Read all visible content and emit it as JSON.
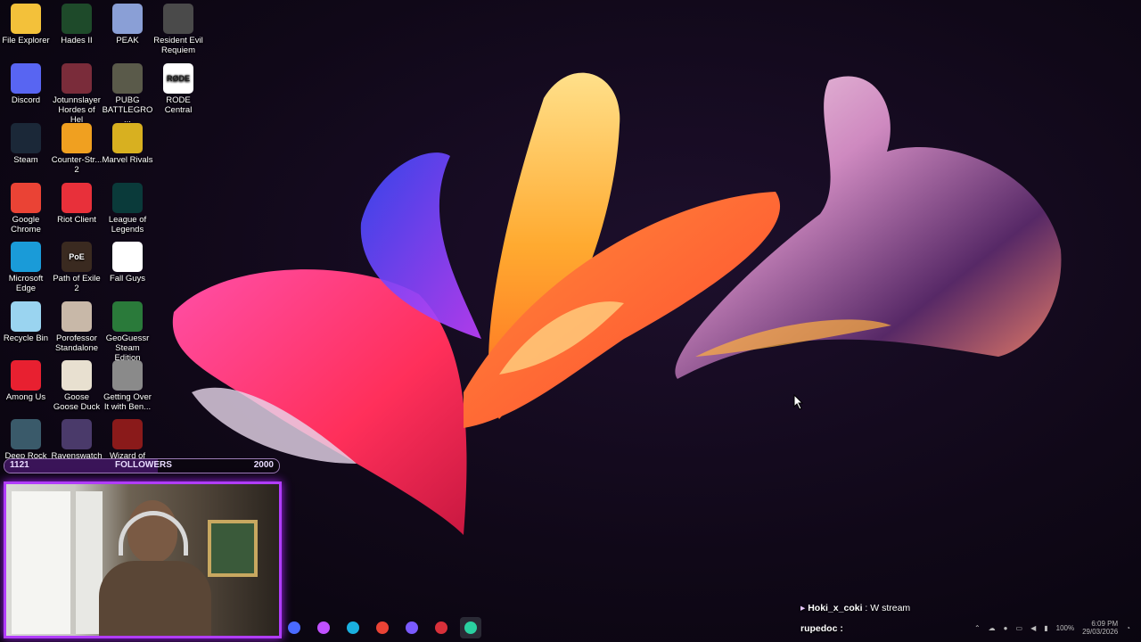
{
  "desktop": {
    "icons": [
      {
        "label": "File Explorer",
        "icon": "folder-icon",
        "color": "#f3c13a",
        "glyph": ""
      },
      {
        "label": "Hades II",
        "icon": "hades-icon",
        "color": "#1e4a2a",
        "glyph": ""
      },
      {
        "label": "PEAK",
        "icon": "peak-icon",
        "color": "#8a9fd6",
        "glyph": ""
      },
      {
        "label": "Resident Evil Requiem",
        "icon": "resident-evil-icon",
        "color": "#4a4a4a",
        "glyph": ""
      },
      {
        "label": "Discord",
        "icon": "discord-icon",
        "color": "#5865f2",
        "glyph": ""
      },
      {
        "label": "Jotunnslayer Hordes of Hel",
        "icon": "jotunnslayer-icon",
        "color": "#7a2c3a",
        "glyph": ""
      },
      {
        "label": "PUBG BATTLEGRO...",
        "icon": "pubg-icon",
        "color": "#5a5a4a",
        "glyph": ""
      },
      {
        "label": "RODE Central",
        "icon": "rode-icon",
        "color": "#ffffff",
        "glyph": "RØDE"
      },
      {
        "label": "Steam",
        "icon": "steam-icon",
        "color": "#1b2838",
        "glyph": ""
      },
      {
        "label": "Counter-Str... 2",
        "icon": "counter-strike-icon",
        "color": "#f0a020",
        "glyph": ""
      },
      {
        "label": "Marvel Rivals",
        "icon": "marvel-rivals-icon",
        "color": "#d8b020",
        "glyph": ""
      },
      {
        "label": "Google Chrome",
        "icon": "chrome-icon",
        "color": "#ea4335",
        "glyph": ""
      },
      {
        "label": "Riot Client",
        "icon": "riot-icon",
        "color": "#e8303a",
        "glyph": ""
      },
      {
        "label": "League of Legends",
        "icon": "league-icon",
        "color": "#0a3a3a",
        "glyph": ""
      },
      {
        "label": "Microsoft Edge",
        "icon": "edge-icon",
        "color": "#1a9bd8",
        "glyph": ""
      },
      {
        "label": "Path of Exile 2",
        "icon": "path-of-exile-icon",
        "color": "#3a2a20",
        "glyph": "PoE"
      },
      {
        "label": "Fall Guys",
        "icon": "file-icon",
        "color": "#ffffff",
        "glyph": ""
      },
      {
        "label": "Recycle Bin",
        "icon": "recycle-bin-icon",
        "color": "#9ad4f0",
        "glyph": ""
      },
      {
        "label": "Porofessor Standalone",
        "icon": "porofessor-icon",
        "color": "#c8b8a8",
        "glyph": ""
      },
      {
        "label": "GeoGuessr Steam Edition",
        "icon": "geoguessr-icon",
        "color": "#2a7a3a",
        "glyph": ""
      },
      {
        "label": "Among Us",
        "icon": "among-us-icon",
        "color": "#e82030",
        "glyph": ""
      },
      {
        "label": "Goose Goose Duck",
        "icon": "goose-icon",
        "color": "#e8e0d0",
        "glyph": ""
      },
      {
        "label": "Getting Over It with Ben...",
        "icon": "hammer-icon",
        "color": "#8a8a8a",
        "glyph": ""
      },
      {
        "label": "Deep Rock",
        "icon": "deep-rock-icon",
        "color": "#3a5a6a",
        "glyph": ""
      },
      {
        "label": "Ravenswatch",
        "icon": "ravenswatch-icon",
        "color": "#4a3a6a",
        "glyph": ""
      },
      {
        "label": "Wizard of",
        "icon": "wizard-icon",
        "color": "#8a1a1a",
        "glyph": ""
      }
    ]
  },
  "overlay": {
    "followers_current": "1121",
    "followers_label": "FOLLOWERS",
    "followers_goal": "2000",
    "followers_progress": 0.56
  },
  "chat": {
    "message_user": "Hoki_x_coki",
    "message_text": "W stream",
    "current_user": "rupedoc :"
  },
  "taskbar": {
    "apps": [
      {
        "icon": "app-icon",
        "color": "#4a6aff"
      },
      {
        "icon": "copilot-icon",
        "color": "#c050ff"
      },
      {
        "icon": "edge-icon",
        "color": "#1ab0e0"
      },
      {
        "icon": "chrome-icon",
        "color": "#ea4335"
      },
      {
        "icon": "discord-icon",
        "color": "#7a5aff"
      },
      {
        "icon": "app-icon",
        "color": "#d8303a"
      },
      {
        "icon": "app-icon",
        "color": "#2ad0a0"
      }
    ],
    "tray": {
      "battery": "100%",
      "time": "6:09 PM",
      "date": "29/03/2026"
    }
  }
}
